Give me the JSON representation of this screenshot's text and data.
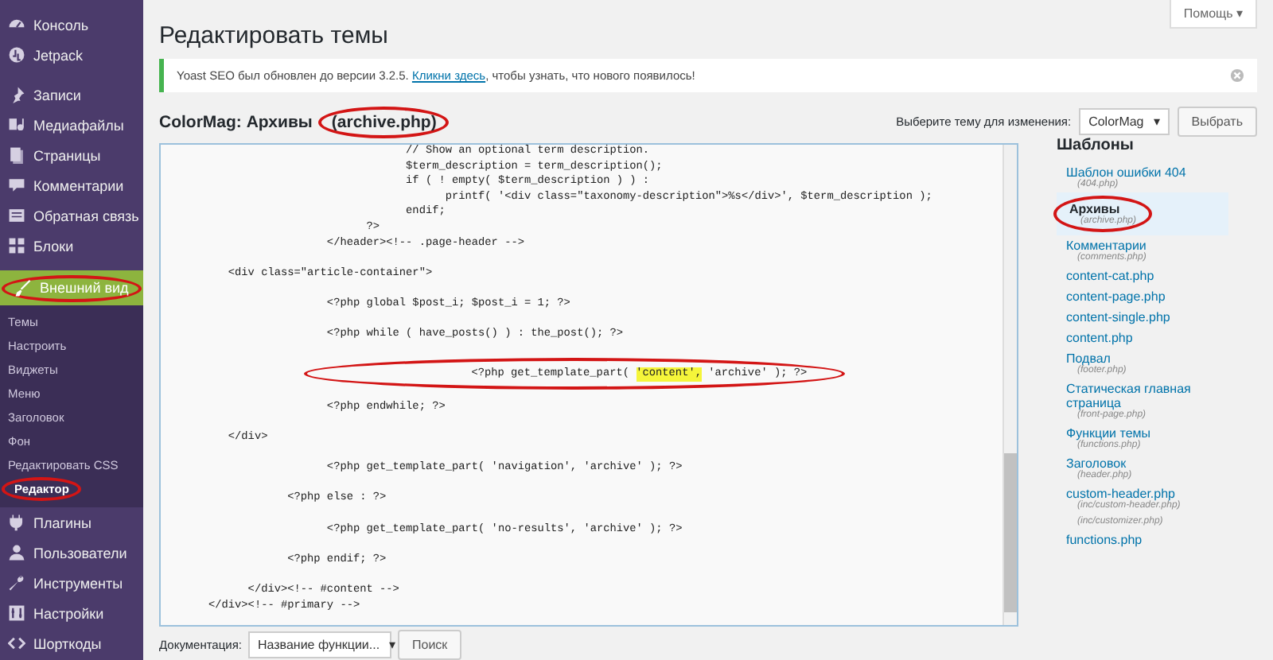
{
  "sidebar": {
    "groups": [
      {
        "items": [
          {
            "label": "Консоль",
            "selected": false,
            "circled": false
          },
          {
            "label": "Jetpack",
            "selected": false,
            "circled": false
          }
        ]
      },
      {
        "items": [
          {
            "label": "Записи",
            "selected": false,
            "circled": false
          },
          {
            "label": "Медиафайлы",
            "selected": false,
            "circled": false
          },
          {
            "label": "Страницы",
            "selected": false,
            "circled": false
          },
          {
            "label": "Комментарии",
            "selected": false,
            "circled": false
          },
          {
            "label": "Обратная связь",
            "selected": false,
            "circled": false
          },
          {
            "label": "Блоки",
            "selected": false,
            "circled": false
          }
        ]
      },
      {
        "items": [
          {
            "label": "Внешний вид",
            "selected": true,
            "circled": true,
            "children": [
              {
                "label": "Темы",
                "selected": false,
                "circled": false
              },
              {
                "label": "Настроить",
                "selected": false,
                "circled": false
              },
              {
                "label": "Виджеты",
                "selected": false,
                "circled": false
              },
              {
                "label": "Меню",
                "selected": false,
                "circled": false
              },
              {
                "label": "Заголовок",
                "selected": false,
                "circled": false
              },
              {
                "label": "Фон",
                "selected": false,
                "circled": false
              },
              {
                "label": "Редактировать CSS",
                "selected": false,
                "circled": false
              },
              {
                "label": "Редактор",
                "selected": true,
                "circled": true
              }
            ]
          },
          {
            "label": "Плагины",
            "selected": false,
            "circled": false
          },
          {
            "label": "Пользователи",
            "selected": false,
            "circled": false
          },
          {
            "label": "Инструменты",
            "selected": false,
            "circled": false
          },
          {
            "label": "Настройки",
            "selected": false,
            "circled": false
          },
          {
            "label": "Шорткоды",
            "selected": false,
            "circled": false
          }
        ]
      }
    ]
  },
  "help_button": "Помощь ▾",
  "page_title": "Редактировать темы",
  "notice": {
    "text_before": "Yoast SEO был обновлен до версии 3.2.5. ",
    "link": "Кликни здесь",
    "text_after": ", чтобы узнать, что нового появилось!"
  },
  "file_heading": {
    "theme_part": "ColorMag: Архивы",
    "file_part": "(archive.php)",
    "file_circled": true
  },
  "theme_picker": {
    "label": "Выберите тему для изменения:",
    "value": "ColorMag",
    "caret": "▾",
    "button": "Выбрать"
  },
  "code_blocks": [
    {
      "lines": [
        {
          "text": "                              // Show an optional term description.",
          "circled": false
        },
        {
          "text": "                              $term_description = term_description();",
          "circled": false
        },
        {
          "text": "                              if ( ! empty( $term_description ) ) :",
          "circled": false
        },
        {
          "text": "                                    printf( '<div class=\"taxonomy-description\">%s</div>', $term_description );",
          "circled": false
        },
        {
          "text": "                              endif;",
          "circled": false
        },
        {
          "text": "                        ?>",
          "circled": false
        },
        {
          "text": "                  </header><!-- .page-header -->",
          "circled": false
        }
      ]
    },
    {
      "lines": [
        {
          "text": "   <div class=\"article-container\">",
          "circled": false
        }
      ]
    },
    {
      "lines": [
        {
          "text": "                  <?php global $post_i; $post_i = 1; ?>",
          "circled": false
        }
      ]
    },
    {
      "lines": [
        {
          "text": "                  <?php while ( have_posts() ) : the_post(); ?>",
          "circled": false
        }
      ]
    },
    {
      "lines": [
        {
          "parts": [
            {
              "text": "                        <?php get_template_part( ",
              "highlighted": false
            },
            {
              "text": "'content',",
              "highlighted": true
            },
            {
              "text": " 'archive' ); ?>",
              "highlighted": false
            }
          ],
          "circled": true
        }
      ]
    },
    {
      "lines": [
        {
          "text": "                  <?php endwhile; ?>",
          "circled": false
        }
      ]
    },
    {
      "lines": [
        {
          "text": "   </div>",
          "circled": false
        }
      ]
    },
    {
      "lines": [
        {
          "text": "                  <?php get_template_part( 'navigation', 'archive' ); ?>",
          "circled": false
        }
      ]
    },
    {
      "lines": [
        {
          "text": "            <?php else : ?>",
          "circled": false
        }
      ]
    },
    {
      "lines": [
        {
          "text": "                  <?php get_template_part( 'no-results', 'archive' ); ?>",
          "circled": false
        }
      ]
    },
    {
      "lines": [
        {
          "text": "            <?php endif; ?>",
          "circled": false
        }
      ]
    },
    {
      "lines": [
        {
          "text": "      </div><!-- #content -->",
          "circled": false
        },
        {
          "text": "</div><!-- #primary -->",
          "circled": false
        }
      ]
    }
  ],
  "templates": {
    "title": "Шаблоны",
    "items": [
      {
        "name": "Шаблон ошибки 404",
        "file": "(404.php)",
        "selected": false,
        "circled": false
      },
      {
        "name": "Архивы",
        "file": "(archive.php)",
        "selected": true,
        "circled": true
      },
      {
        "name": "Комментарии",
        "file": "(comments.php)",
        "selected": false,
        "circled": false
      },
      {
        "name": "content-cat.php",
        "selected": false,
        "circled": false
      },
      {
        "name": "content-page.php",
        "selected": false,
        "circled": false
      },
      {
        "name": "content-single.php",
        "selected": false,
        "circled": false
      },
      {
        "name": "content.php",
        "selected": false,
        "circled": false
      },
      {
        "name": "Подвал",
        "file": "(footer.php)",
        "selected": false,
        "circled": false
      },
      {
        "name": "Статическая главная страница",
        "file": "(front-page.php)",
        "selected": false,
        "circled": false
      },
      {
        "name": "Функции темы",
        "file": "(functions.php)",
        "selected": false,
        "circled": false
      },
      {
        "name": "Заголовок",
        "file": "(header.php)",
        "selected": false,
        "circled": false
      },
      {
        "name": "custom-header.php",
        "file": "(inc/custom-header.php)",
        "selected": false,
        "circled": false
      },
      {
        "file": "(inc/customizer.php)",
        "selected": false,
        "circled": false
      },
      {
        "name": "functions.php",
        "selected": false,
        "circled": false
      }
    ]
  },
  "documentation": {
    "label": "Документация:",
    "placeholder": "Название функции...",
    "caret": "▾",
    "button": "Поиск"
  }
}
